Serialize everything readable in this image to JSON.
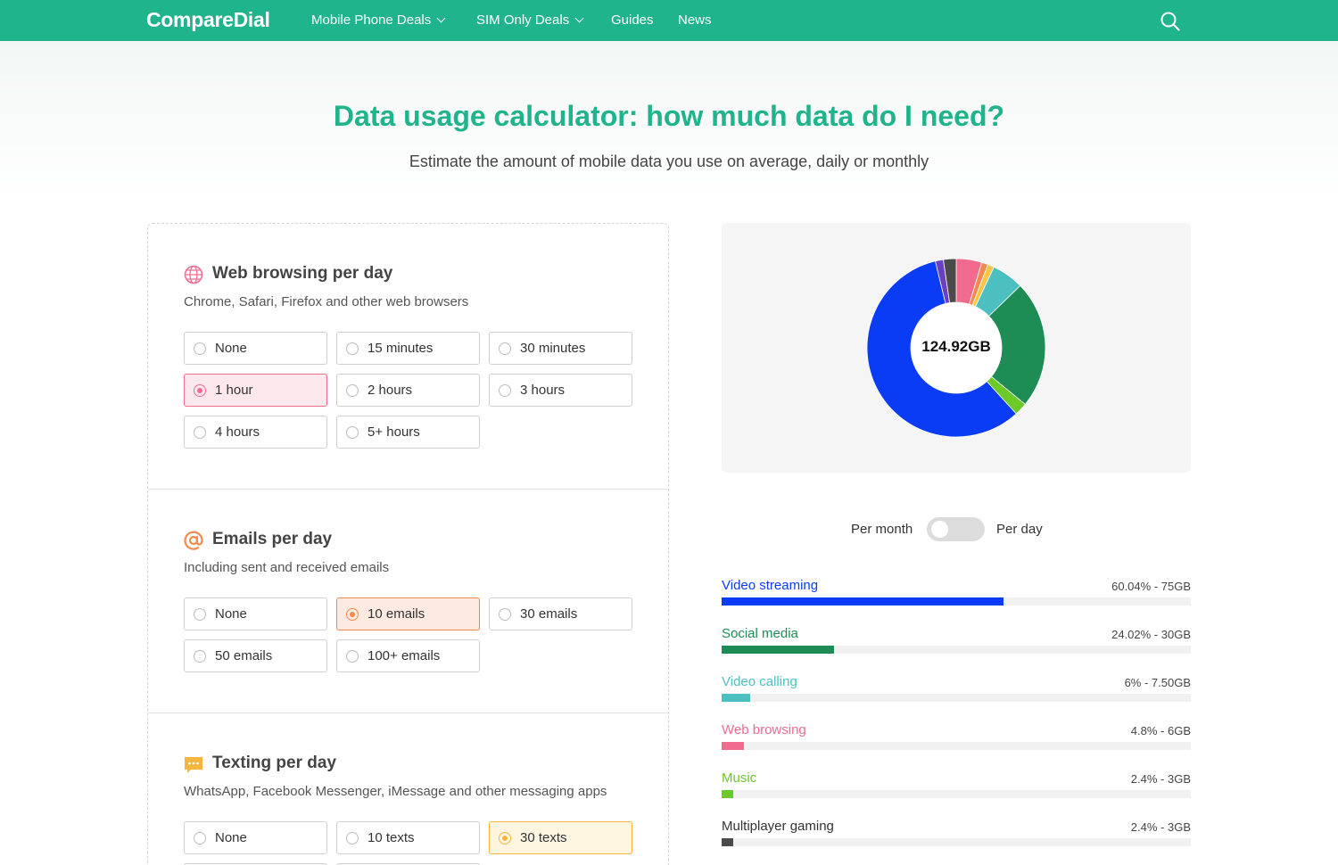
{
  "nav": {
    "logo": "CompareDial",
    "items": [
      {
        "label": "Mobile Phone Deals",
        "dropdown": true
      },
      {
        "label": "SIM Only Deals",
        "dropdown": true
      },
      {
        "label": "Guides",
        "dropdown": false
      },
      {
        "label": "News",
        "dropdown": false
      }
    ],
    "search_icon": "search-icon"
  },
  "hero": {
    "title": "Data usage calculator: how much data do I need?",
    "subtitle": "Estimate the amount of mobile data you use on average, daily or monthly"
  },
  "sections": [
    {
      "title": "Web browsing per day",
      "description": "Chrome, Safari, Firefox and other web browsers",
      "icon": "globe-icon",
      "accent": "#f06b8e",
      "options": [
        "None",
        "15 minutes",
        "30 minutes",
        "1 hour",
        "2 hours",
        "3 hours",
        "4 hours",
        "5+ hours"
      ],
      "selected": "1 hour"
    },
    {
      "title": "Emails per day",
      "description": "Including sent and received emails",
      "icon": "at-sign-icon",
      "accent": "#f28a4d",
      "options": [
        "None",
        "10 emails",
        "30 emails",
        "50 emails",
        "100+ emails"
      ],
      "selected": "10 emails"
    },
    {
      "title": "Texting per day",
      "description": "WhatsApp, Facebook Messenger, iMessage and other messaging apps",
      "icon": "chat-bubble-icon",
      "accent": "#f5b53e",
      "options": [
        "None",
        "10 texts",
        "30 texts"
      ],
      "selected": "30 texts"
    }
  ],
  "summary": {
    "total": "124.92GB",
    "toggle": {
      "left_label": "Per month",
      "right_label": "Per day",
      "state": "Per month"
    }
  },
  "chart_data": {
    "type": "pie",
    "center_label": "124.92GB",
    "categories": [
      "Video streaming",
      "Social media",
      "Video calling",
      "Web browsing",
      "Music",
      "Multiplayer gaming"
    ],
    "values": [
      60.04,
      24.02,
      6,
      4.8,
      2.4,
      2.4
    ],
    "labels": [
      "60.04% - 75GB",
      "24.02% - 30GB",
      "6% - 7.50GB",
      "4.8% - 6GB",
      "2.4% - 3GB",
      "2.4% - 3GB"
    ],
    "colors": [
      "#0a3cf5",
      "#1e8c55",
      "#4cc0c0",
      "#f06b8e",
      "#6bc928",
      "#4a4a4a"
    ],
    "extra_slices": [
      {
        "value": 1.2,
        "color": "#f28a4d"
      },
      {
        "value": 1.2,
        "color": "#f5c64a"
      },
      {
        "value": 1.5,
        "color": "#6a3fc0"
      }
    ]
  }
}
